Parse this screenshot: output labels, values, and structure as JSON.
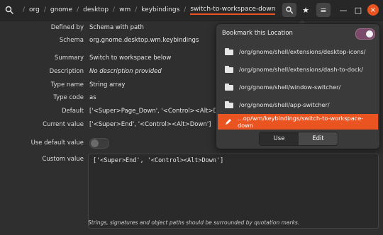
{
  "header": {
    "breadcrumbs": [
      "org",
      "gnome",
      "desktop",
      "wm",
      "keybindings",
      "switch-to-workspace-down"
    ],
    "buttons": {
      "search_icon": "search-icon",
      "bookmark_icon": "star-icon",
      "menu_icon": "menu-icon",
      "close_icon": "close-icon"
    }
  },
  "props": {
    "defined_by": {
      "label": "Defined by",
      "value": "Schema with path"
    },
    "schema": {
      "label": "Schema",
      "value": "org.gnome.desktop.wm.keybindings"
    },
    "summary": {
      "label": "Summary",
      "value": "Switch to workspace below"
    },
    "description": {
      "label": "Description",
      "value": "No description provided"
    },
    "type_name": {
      "label": "Type name",
      "value": "String array"
    },
    "type_code": {
      "label": "Type code",
      "value": "as"
    },
    "default": {
      "label": "Default",
      "value": "['<Super>Page_Down', '<Control><Alt>Down']"
    },
    "current_value": {
      "label": "Current value",
      "value": "['<Super>End', '<Control><Alt>Down']"
    },
    "use_default": {
      "label": "Use default value",
      "on": false
    },
    "custom_value": {
      "label": "Custom value",
      "value": "['<Super>End', '<Control><Alt>Down']"
    },
    "note": "Strings, signatures and object paths should be surrounded by quotation marks."
  },
  "popover": {
    "title": "Bookmark this Location",
    "switch_on": true,
    "items": [
      "/org/gnome/shell/extensions/desktop-icons/",
      "/org/gnome/shell/extensions/dash-to-dock/",
      "/org/gnome/shell/window-switcher/",
      "/org/gnome/shell/app-switcher/"
    ],
    "active_item": "...op/wm/keybindings/switch-to-workspace-down",
    "use_label": "Use",
    "edit_label": "Edit"
  },
  "colors": {
    "accent": "#e95420",
    "bg": "#2f2f2f",
    "header": "#272727"
  }
}
